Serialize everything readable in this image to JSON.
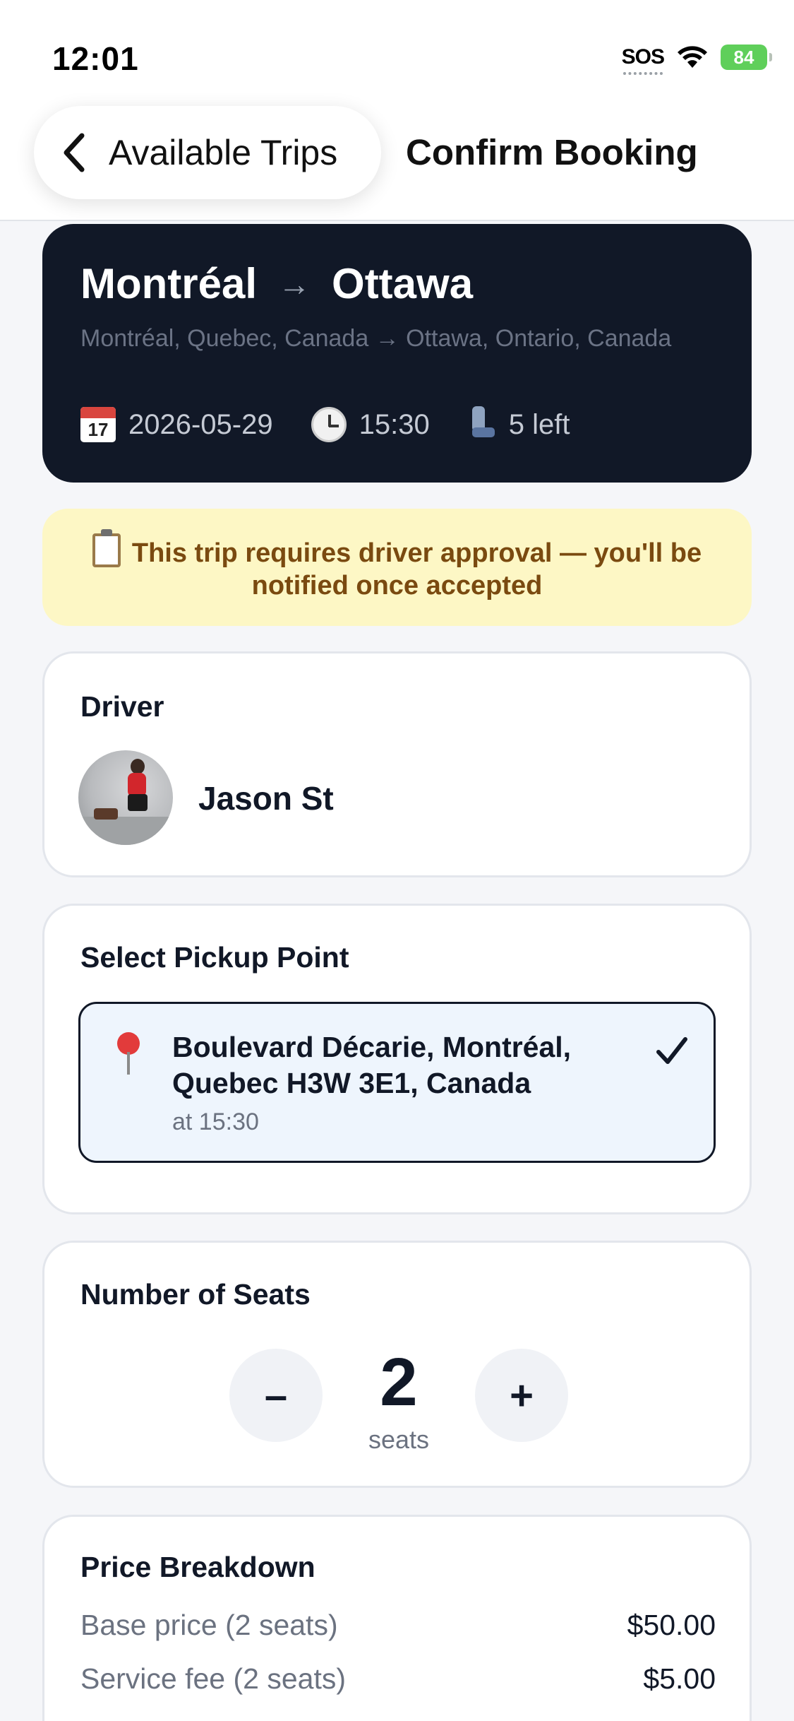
{
  "status_bar": {
    "time": "12:01",
    "sos": "SOS",
    "battery": "84"
  },
  "header": {
    "back_label": "Available Trips",
    "title": "Confirm Booking"
  },
  "trip": {
    "origin": "Montréal",
    "arrow": "→",
    "destination": "Ottawa",
    "full_route": "Montréal, Quebec, Canada → Ottawa, Ontario, Canada",
    "date": "2026-05-29",
    "calendar_icon_day": "17",
    "time": "15:30",
    "seats_left": "5 left"
  },
  "approval_notice": "This trip requires driver approval — you'll be notified once accepted",
  "driver": {
    "section_title": "Driver",
    "name": "Jason St"
  },
  "pickup": {
    "section_title": "Select Pickup Point",
    "address": "Boulevard Décarie, Montréal, Quebec H3W 3E1, Canada",
    "time": "at 15:30"
  },
  "seats": {
    "section_title": "Number of Seats",
    "minus_label": "–",
    "plus_label": "+",
    "count": "2",
    "unit": "seats"
  },
  "price": {
    "section_title": "Price Breakdown",
    "rows": [
      {
        "label": "Base price (2 seats)",
        "value": "$50.00"
      },
      {
        "label": "Service fee (2 seats)",
        "value": "$5.00"
      }
    ]
  },
  "colors": {
    "hero_bg": "#111827",
    "banner_bg": "#fdf7c5",
    "banner_text": "#7a4a10",
    "selected_bg": "#eef5fd",
    "battery": "#5fcf5a"
  }
}
